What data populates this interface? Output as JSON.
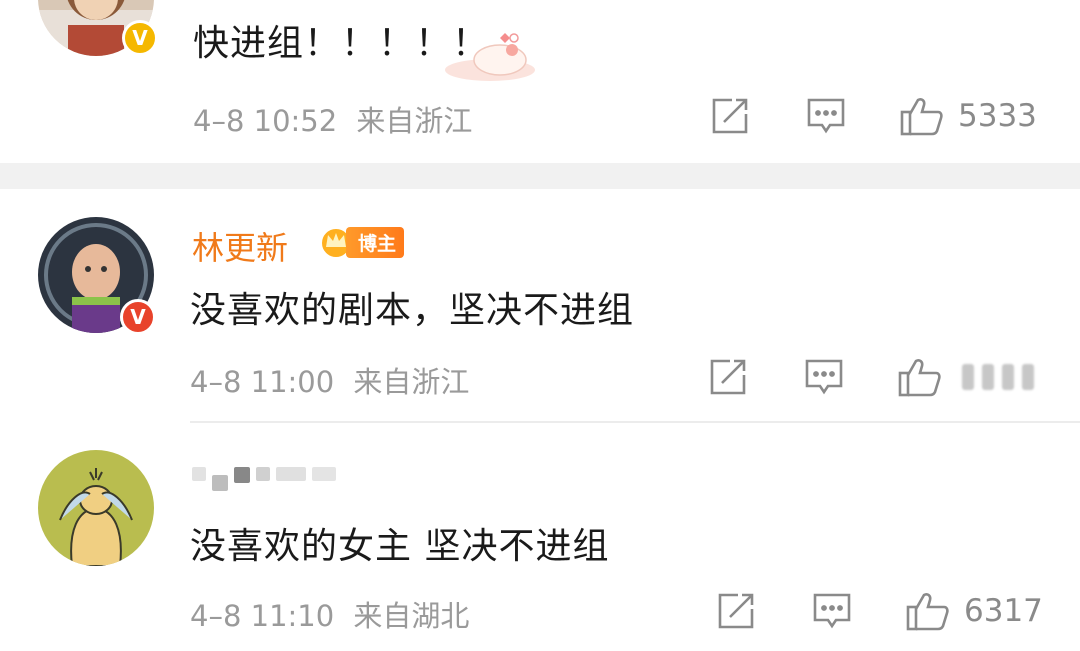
{
  "comments": [
    {
      "text": "快进组！！！！！",
      "time": "4–8 10:52",
      "location": "来自浙江",
      "likes": "5333",
      "verified": "yellow"
    },
    {
      "username": "林更新",
      "badge": "博主",
      "text": "没喜欢的剧本，坚决不进组",
      "time": "4–8 11:00",
      "location": "来自浙江",
      "likes_hidden": true,
      "verified": "red"
    },
    {
      "username_hidden": true,
      "text": "没喜欢的女主 坚决不进组",
      "time": "4–8 11:10",
      "location": "来自湖北",
      "likes": "6317"
    }
  ],
  "icons": [
    "repost-icon",
    "comment-icon",
    "like-icon",
    "verified-v-icon",
    "crown-icon"
  ],
  "colors": {
    "username_orange": "#f07a1a",
    "meta_gray": "#9a9a9a",
    "verified_yellow": "#f5b800",
    "verified_red": "#e8432b",
    "divider": "#f1f1f1"
  }
}
